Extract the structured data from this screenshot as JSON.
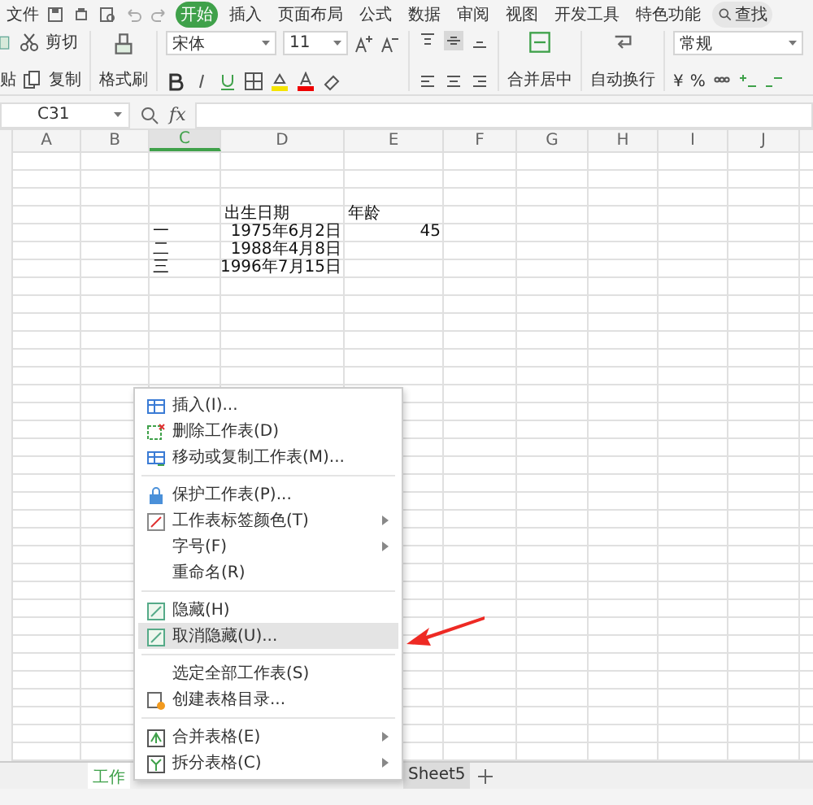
{
  "menu_bar": {
    "file": "文件",
    "tabs": [
      {
        "label": "开始",
        "selected": true
      },
      {
        "label": "插入",
        "selected": false
      },
      {
        "label": "页面布局",
        "selected": false
      },
      {
        "label": "公式",
        "selected": false
      },
      {
        "label": "数据",
        "selected": false
      },
      {
        "label": "审阅",
        "selected": false
      },
      {
        "label": "视图",
        "selected": false
      },
      {
        "label": "开发工具",
        "selected": false
      },
      {
        "label": "特色功能",
        "selected": false
      }
    ],
    "search": "查找"
  },
  "ribbon": {
    "paste": "贴",
    "cut": "剪切",
    "copy": "复制",
    "format_painter": "格式刷",
    "font": "宋体",
    "font_size": "11",
    "merge": "合并居中",
    "wrap": "自动换行",
    "number_format": "常规",
    "currency": "¥",
    "percent": "%"
  },
  "formula_bar": {
    "name_box": "C31",
    "fx": "fx"
  },
  "columns": [
    {
      "label": "A",
      "selected": false
    },
    {
      "label": "B",
      "selected": false
    },
    {
      "label": "C",
      "selected": true
    },
    {
      "label": "D",
      "selected": false
    },
    {
      "label": "E",
      "selected": false
    },
    {
      "label": "F",
      "selected": false
    },
    {
      "label": "G",
      "selected": false
    },
    {
      "label": "H",
      "selected": false
    },
    {
      "label": "I",
      "selected": false
    },
    {
      "label": "J",
      "selected": false
    }
  ],
  "rows": [
    {
      "D": "出生日期",
      "E": "年龄"
    },
    {
      "C": "一",
      "D": "1975年6月2日",
      "E": "45"
    },
    {
      "C": "二",
      "D": "1988年4月8日"
    },
    {
      "C": "三",
      "D": "1996年7月15日"
    }
  ],
  "sheet_tabs": [
    {
      "label": "工作",
      "selected": true
    },
    {
      "label": "Sheet5",
      "selected": false
    }
  ],
  "context_menu": [
    {
      "kind": "item",
      "label": "插入(I)...",
      "submenu": false,
      "selected": false
    },
    {
      "kind": "item",
      "label": "删除工作表(D)",
      "submenu": false,
      "selected": false
    },
    {
      "kind": "item",
      "label": "移动或复制工作表(M)...",
      "submenu": false,
      "selected": false
    },
    {
      "kind": "separator"
    },
    {
      "kind": "item",
      "label": "保护工作表(P)...",
      "submenu": false,
      "selected": false
    },
    {
      "kind": "item",
      "label": "工作表标签颜色(T)",
      "submenu": true,
      "selected": false
    },
    {
      "kind": "item",
      "label": "字号(F)",
      "submenu": true,
      "selected": false
    },
    {
      "kind": "item",
      "label": "重命名(R)",
      "submenu": false,
      "selected": false
    },
    {
      "kind": "separator"
    },
    {
      "kind": "item",
      "label": "隐藏(H)",
      "submenu": false,
      "selected": false
    },
    {
      "kind": "item",
      "label": "取消隐藏(U)...",
      "submenu": false,
      "selected": true
    },
    {
      "kind": "separator"
    },
    {
      "kind": "item",
      "label": "选定全部工作表(S)",
      "submenu": false,
      "selected": false
    },
    {
      "kind": "item",
      "label": "创建表格目录...",
      "submenu": false,
      "selected": false
    },
    {
      "kind": "separator"
    },
    {
      "kind": "item",
      "label": "合并表格(E)",
      "submenu": true,
      "selected": false
    },
    {
      "kind": "item",
      "label": "拆分表格(C)",
      "submenu": true,
      "selected": false
    }
  ]
}
